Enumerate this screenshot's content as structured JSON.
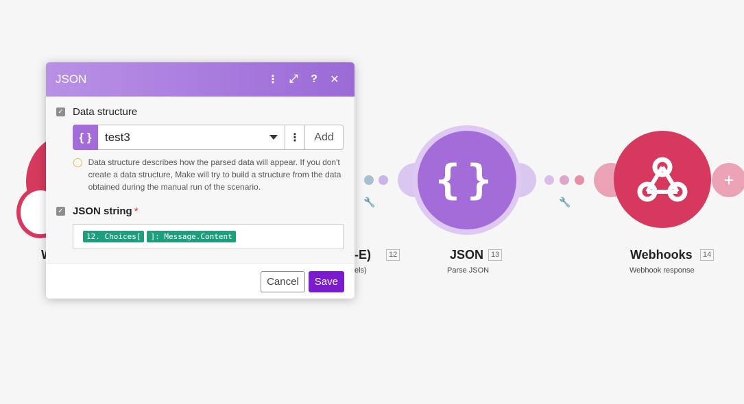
{
  "modal": {
    "title": "JSON",
    "header_icons": [
      "more-vertical-icon",
      "expand-icon",
      "help-icon",
      "close-icon"
    ],
    "data_structure": {
      "label": "Data structure",
      "selected": "test3",
      "add_label": "Add",
      "hint": "Data structure describes how the parsed data will appear. If you don't create a data structure, Make will try to build a structure from the data obtained during the manual run of the scenario."
    },
    "json_string": {
      "label": "JSON string",
      "required_mark": "*",
      "tokens": [
        "12. Choices[",
        "]: Message.Content"
      ]
    },
    "cancel_label": "Cancel",
    "save_label": "Save"
  },
  "nodes": [
    {
      "title": "W",
      "id": "",
      "subtitle": ""
    },
    {
      "title": "-E)",
      "id": "12",
      "subtitle": "els)"
    },
    {
      "title": "JSON",
      "id": "13",
      "subtitle": "Parse JSON"
    },
    {
      "title": "Webhooks",
      "id": "14",
      "subtitle": "Webhook response"
    }
  ],
  "colors": {
    "json_accent": "#a46cd9",
    "webhook_accent": "#d6395d",
    "save_button": "#7a1ccc",
    "token_green": "#1e9e7a"
  }
}
